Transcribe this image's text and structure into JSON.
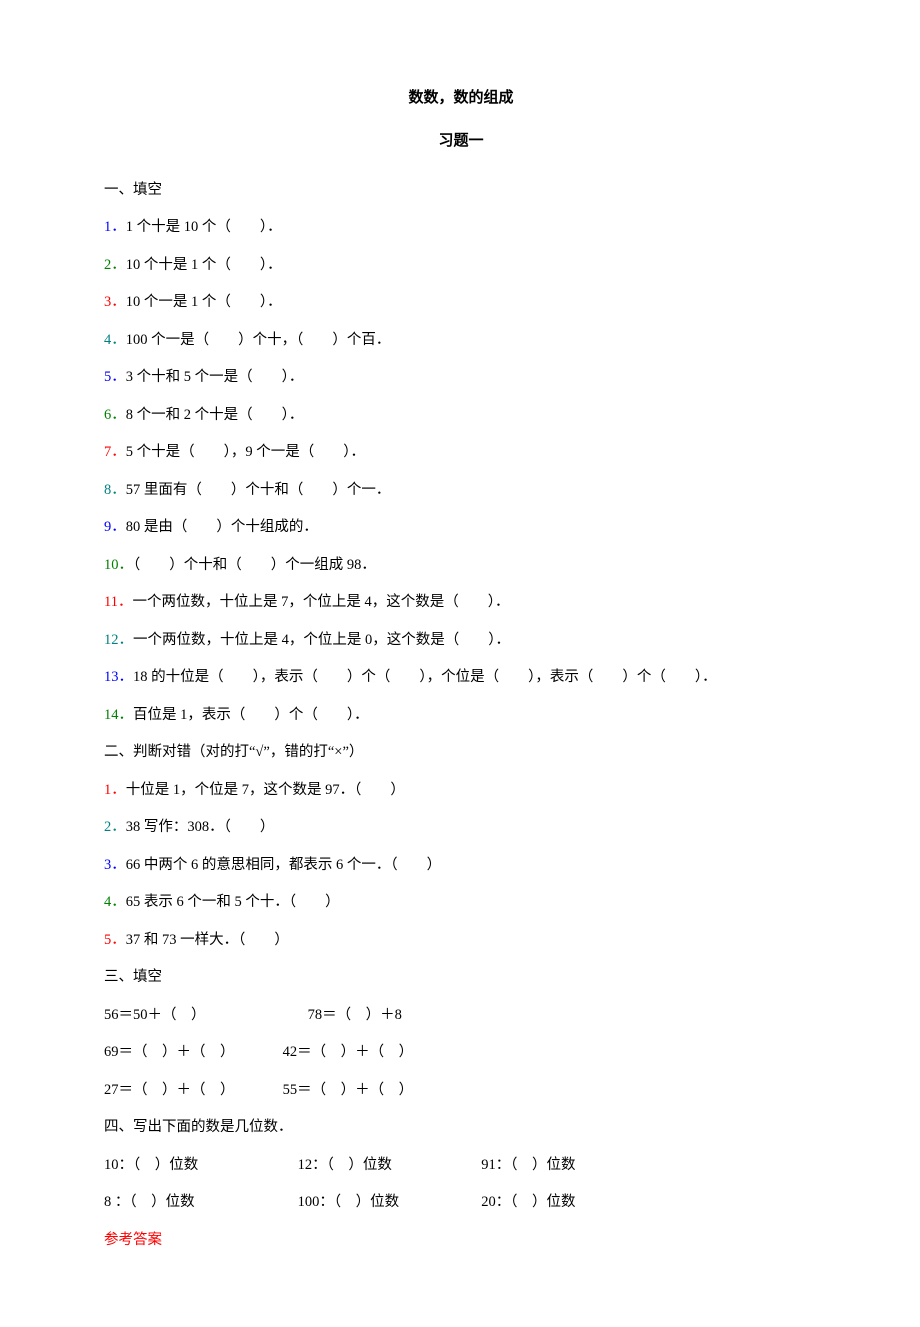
{
  "title": "数数，数的组成",
  "subtitle": "习题一",
  "section1_header": "一、填空",
  "s1": {
    "q1_num": "1．",
    "q1_text": "1 个十是 10 个（　　）．",
    "q2_num": "2．",
    "q2_text": "10 个十是 1 个（　　）．",
    "q3_num": "3．",
    "q3_text": "10 个一是 1 个（　　）．",
    "q4_num": "4．",
    "q4_text": "100 个一是（　　）个十，（　　）个百．",
    "q5_num": "5．",
    "q5_text": "3 个十和 5 个一是（　　）．",
    "q6_num": "6．",
    "q6_text": "8 个一和 2 个十是（　　）．",
    "q7_num": "7．",
    "q7_text": "5 个十是（　　），9 个一是（　　）．",
    "q8_num": "8．",
    "q8_text": "57 里面有（　　）个十和（　　）个一．",
    "q9_num": "9．",
    "q9_text": "80 是由（　　）个十组成的．",
    "q10_num": "10．",
    "q10_text": "（　　）个十和（　　）个一组成 98．",
    "q11_num": "11．",
    "q11_text": "一个两位数，十位上是 7，个位上是 4，这个数是（　　）．",
    "q12_num": "12．",
    "q12_text": "一个两位数，十位上是 4，个位上是 0，这个数是（　　）．",
    "q13_num": "13．",
    "q13_text": "18 的十位是（　　），表示（　　）个（　　），个位是（　　），表示（　　）个（　　）．",
    "q14_num": "14．",
    "q14_text": "百位是 1，表示（　　）个（　　）．"
  },
  "section2_header": "二、判断对错（对的打“√”，错的打“×”）",
  "s2": {
    "q1_num": "1．",
    "q1_text": "十位是 1，个位是 7，这个数是 97．（　　）",
    "q2_num": "2．",
    "q2_text": "38 写作：308．（　　）",
    "q3_num": "3．",
    "q3_text": "66 中两个 6 的意思相同，都表示 6 个一．（　　）",
    "q4_num": "4．",
    "q4_text": "65 表示 6 个一和 5 个十．（　　）",
    "q5_num": "5．",
    "q5_text": "37 和 73 一样大．（　　）"
  },
  "section3_header": "三、填空",
  "s3": {
    "r1c1": "56＝50＋（　）",
    "r1c2": "78＝（　）＋8",
    "r2c1": "69＝（　）＋（　）",
    "r2c2": "42＝（　）＋（　）",
    "r3c1": "27＝（　）＋（　）",
    "r3c2": "55＝（　）＋（　）"
  },
  "section4_header": "四、写出下面的数是几位数．",
  "s4": {
    "r1c1": "10：（　）位数",
    "r1c2": "12：（　）位数",
    "r1c3": "91：（　）位数",
    "r2c1": "8 ：（　）位数",
    "r2c2": "100：（　）位数",
    "r2c3": "20：（　）位数"
  },
  "answer_header": "参考答案"
}
